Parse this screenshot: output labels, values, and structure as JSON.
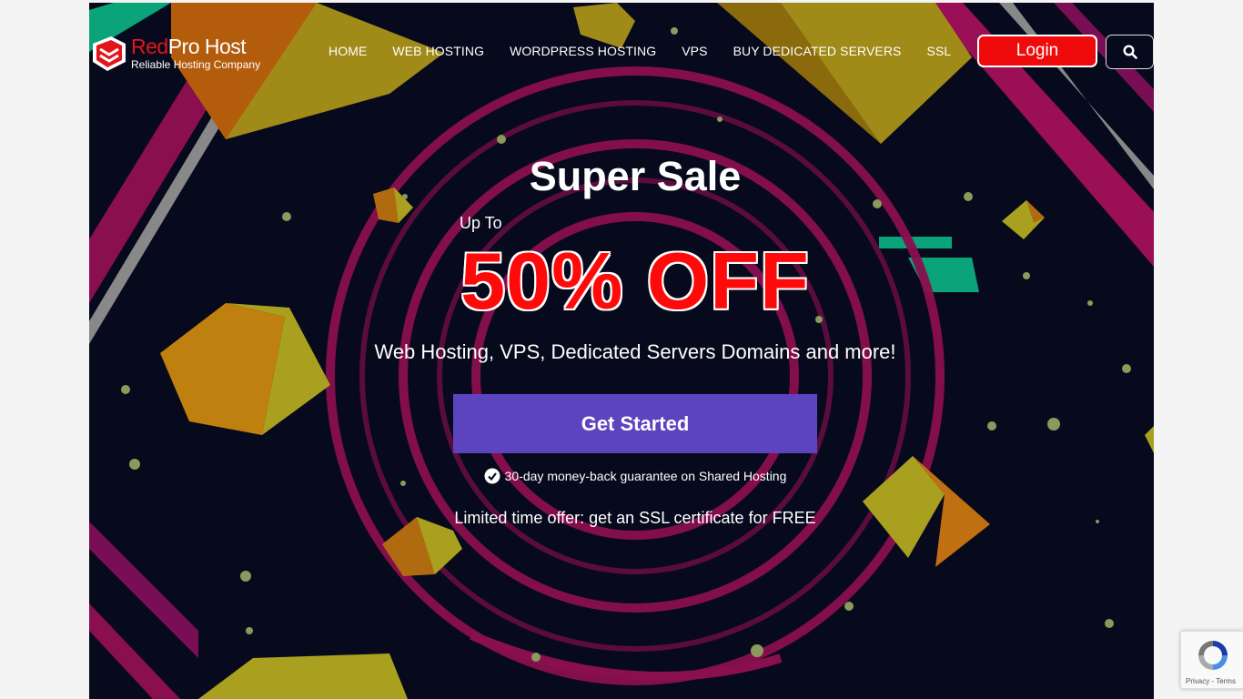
{
  "brand": {
    "name_red": "Red",
    "name_rest": "Pro Host",
    "tagline": "Reliable Hosting Company"
  },
  "nav": [
    {
      "label": "HOME"
    },
    {
      "label": "WEB HOSTING"
    },
    {
      "label": "WORDPRESS HOSTING"
    },
    {
      "label": "VPS"
    },
    {
      "label": "BUY DEDICATED SERVERS"
    },
    {
      "label": "SSL"
    }
  ],
  "header": {
    "login_label": "Login",
    "search_icon": "search-icon"
  },
  "hero": {
    "title": "Super Sale",
    "upto": "Up To",
    "discount": "50% OFF",
    "subtitle": "Web Hosting, VPS, Dedicated Servers Domains and more!",
    "cta_label": "Get Started",
    "guarantee": "30-day money-back guarantee on Shared Hosting",
    "offer": "Limited time offer: get an SSL certificate for FREE"
  },
  "recaptcha": {
    "links": "Privacy - Terms"
  },
  "colors": {
    "accent_red": "#ef0b0b",
    "cta_purple": "#5b44bd",
    "bg_dark": "#070a1c",
    "magenta": "#a0115a",
    "cube_gold": "#b08a1a"
  }
}
